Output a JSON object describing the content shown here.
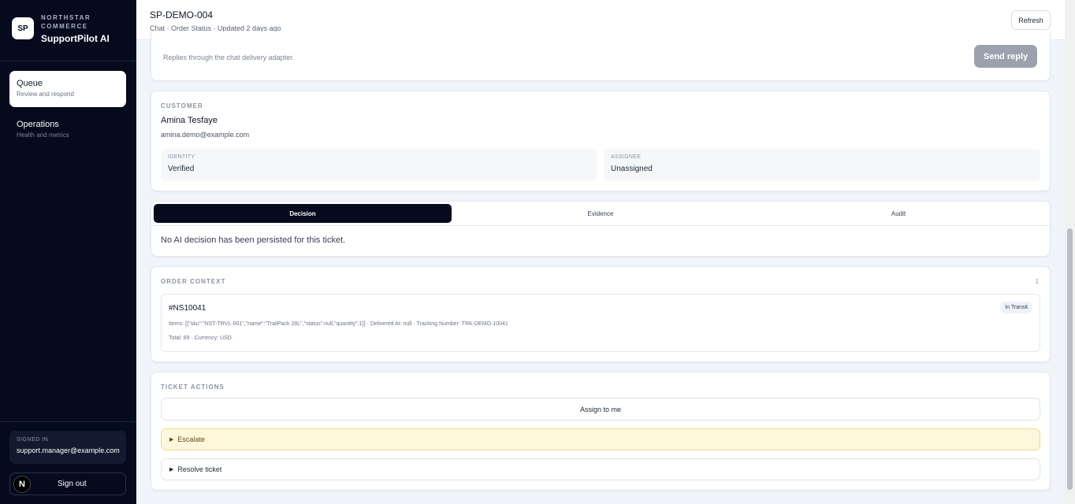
{
  "sidebar": {
    "logo_initials": "SP",
    "org_name": "NORTHSTAR COMMERCE",
    "app_name": "SupportPilot AI",
    "nav": [
      {
        "label": "Queue",
        "sub": "Review and respond"
      },
      {
        "label": "Operations",
        "sub": "Health and metrics"
      }
    ],
    "signed_in_label": "SIGNED IN",
    "signed_in_email": "support.manager@example.com",
    "avatar_initial": "N",
    "signout_label": "Sign out"
  },
  "header": {
    "ticket_id": "SP-DEMO-004",
    "meta": "Chat · Order Status · Updated 2 days ago",
    "refresh_label": "Refresh"
  },
  "reply": {
    "hint": "Replies through the chat delivery adapter.",
    "send_label": "Send reply"
  },
  "customer": {
    "section_label": "CUSTOMER",
    "name": "Amina Tesfaye",
    "email": "amina.demo@example.com",
    "identity_label": "IDENTITY",
    "identity_value": "Verified",
    "assignee_label": "ASSIGNEE",
    "assignee_value": "Unassigned"
  },
  "decision": {
    "tabs": [
      "Decision",
      "Evidence",
      "Audit"
    ],
    "empty_text": "No AI decision has been persisted for this ticket."
  },
  "order_context": {
    "section_label": "ORDER CONTEXT",
    "count": "1",
    "order_id": "#NS10041",
    "status": "In Transit",
    "items_line": "Items: [{\"sku\":\"NST-TRVL-001\",\"name\":\"TrailPack 28L\",\"status\":null,\"quantity\":1}] · Delivered At: null · Tracking Number: TRK-DEMO-10041",
    "total_line": "Total: 89 · Currency: USD"
  },
  "actions": {
    "section_label": "TICKET ACTIONS",
    "assign_label": "Assign to me",
    "escalate_label": "Escalate",
    "resolve_label": "Resolve ticket"
  }
}
